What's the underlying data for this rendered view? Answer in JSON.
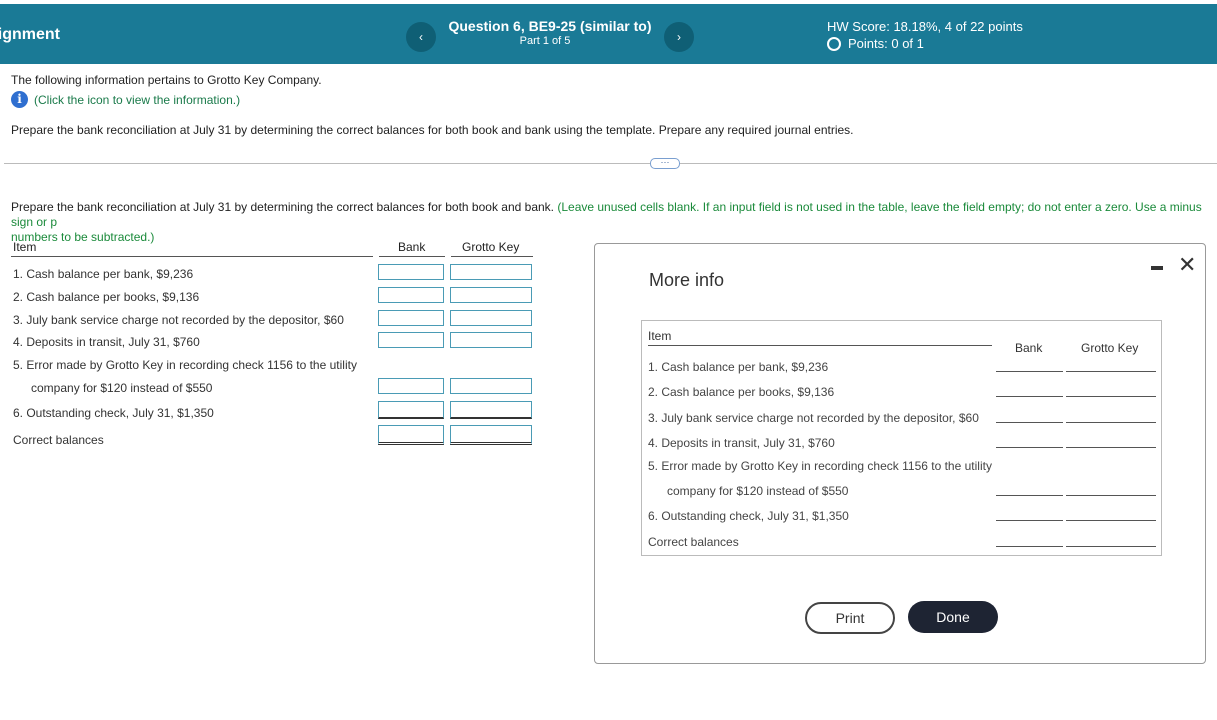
{
  "header": {
    "assignment_title": "Assignment",
    "prev_icon": "‹",
    "next_icon": "›",
    "question_title": "Question 6, BE9-25 (similar to)",
    "question_part": "Part 1 of 5",
    "hw_score": "HW Score: 18.18%, 4 of 22 points",
    "points": "Points: 0 of 1"
  },
  "intro": {
    "company_text": "The following information pertains to Grotto Key Company.",
    "info_link": "(Click the icon to view the information.)",
    "prepare_text": "Prepare the bank reconciliation at July 31 by determining the correct balances for both book and bank using the template. Prepare any required journal entries."
  },
  "more_button": "⋯",
  "instructions": {
    "main": "Prepare the bank reconciliation at July 31 by determining the correct balances for both book and bank.",
    "green_line1": "(Leave unused cells blank. If an input field is not used in the table, leave the field empty; do not enter a zero. Use a minus sign or p",
    "green_line2": "numbers to be subtracted.)"
  },
  "table": {
    "headers": {
      "item": "Item",
      "bank": "Bank",
      "book": "Grotto Key"
    },
    "rows": [
      "1.   Cash balance per bank, $9,236",
      "2.   Cash balance per books, $9,136",
      "3.   July bank service charge not recorded by the depositor, $60",
      "4.   Deposits in transit, July 31, $760",
      "5.   Error made by Grotto Key in recording check 1156 to the utility",
      "company for $120 instead of $550",
      "6.   Outstanding check, July 31, $1,350",
      "Correct balances"
    ]
  },
  "modal": {
    "title": "More info",
    "headers": {
      "item": "Item",
      "bank": "Bank",
      "book": "Grotto Key"
    },
    "rows": [
      "1.   Cash balance per bank, $9,236",
      "2.   Cash balance per books, $9,136",
      "3.   July bank service charge not recorded by the depositor, $60",
      "4.   Deposits in transit, July 31, $760",
      "5.   Error made by Grotto Key in recording check 1156 to the utility",
      "company for $120 instead of $550",
      "6.   Outstanding check, July 31, $1,350",
      "Correct balances"
    ],
    "print_label": "Print",
    "done_label": "Done",
    "close_icon": "✕"
  },
  "colors": {
    "header_bg": "#1a7a96",
    "input_border": "#4a9bb5",
    "done_bg": "#1e2433",
    "green_text": "#1a8a3a"
  }
}
